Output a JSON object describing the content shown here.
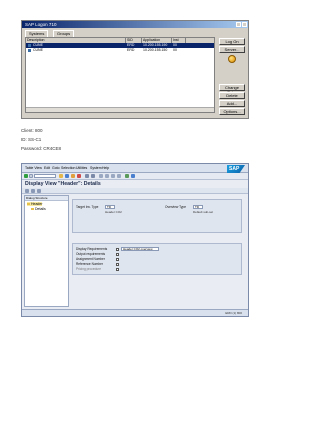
{
  "logon": {
    "title": "SAP Logon 710",
    "tabs": [
      "Systems",
      "Groups"
    ],
    "columns": [
      "Description",
      "SID",
      "Application Server",
      "Inst"
    ],
    "rows": [
      {
        "name": "CUNE",
        "sid": "ERD",
        "server": "10.200.155.190",
        "inst": "00"
      },
      {
        "name": "CUNE",
        "sid": "ERD",
        "server": "10.200.155.150",
        "inst": "00"
      }
    ],
    "buttons_top": [
      "Log On",
      "Server..."
    ],
    "buttons_bottom": [
      "Change Entry",
      "Delete",
      "Add...",
      "Options..."
    ]
  },
  "captions": [
    "Client: 800",
    "ID: SS-C1",
    "Password: CR4CE8"
  ],
  "gui": {
    "menus": [
      "Table View",
      "Edit",
      "Goto",
      "Selection",
      "Utilities",
      "System",
      "Help"
    ],
    "logo_text": "SAP",
    "title": "Display View \"Header\": Details",
    "tree": {
      "header": "Dialog Structure",
      "nodes": [
        "Header",
        "Details"
      ]
    },
    "group1": {
      "label1": "Target Inv. Type",
      "value1": "TD",
      "desc1": "Header CO2",
      "label2": "Overview Type",
      "value2": "TD",
      "desc2": "Default sub-sel"
    },
    "group2": {
      "rows": [
        {
          "label": "Display Requirements",
          "value": "Header CO2 overview"
        },
        {
          "label": "Output requirements",
          "value": ""
        },
        {
          "label": "Assignment Number",
          "value": ""
        },
        {
          "label": "Reference Number",
          "value": ""
        },
        {
          "label": "Pricing procedure",
          "value": ""
        }
      ]
    },
    "status_text": "ERD (1) 800"
  }
}
